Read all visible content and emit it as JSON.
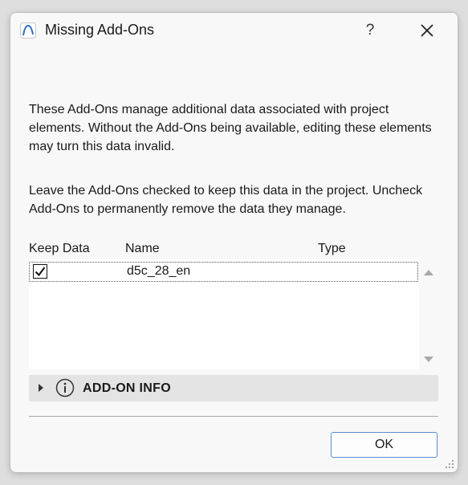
{
  "window": {
    "title": "Missing Add-Ons",
    "help_label": "?",
    "app_icon": "archicad-arc-icon",
    "close_icon": "close-icon"
  },
  "body": {
    "paragraph1": "These Add-Ons manage additional data associated with project elements. Without the Add-Ons being available, editing these elements may turn this data invalid.",
    "paragraph2": "Leave the Add-Ons checked to keep this data in the project. Uncheck Add-Ons to permanently remove the data they manage."
  },
  "table": {
    "columns": [
      "Keep Data",
      "Name",
      "Type"
    ],
    "rows": [
      {
        "keep_data": true,
        "name": "d5c_28_en",
        "type": ""
      }
    ]
  },
  "info_section": {
    "label": "ADD-ON INFO",
    "expanded": false,
    "icon": "info-icon"
  },
  "footer": {
    "ok_label": "OK"
  },
  "colors": {
    "dialog_bg": "#f8f8f8",
    "info_bar_bg": "#e4e4e4",
    "button_border": "#5a8dd0",
    "app_icon": "#2d6fc4"
  }
}
